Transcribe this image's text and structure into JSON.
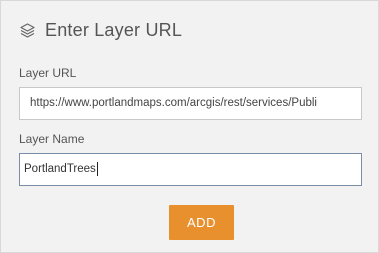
{
  "header": {
    "icon": "layers-icon",
    "title": "Enter Layer URL"
  },
  "form": {
    "url_label": "Layer URL",
    "url_value": "https://www.portlandmaps.com/arcgis/rest/services/Publi",
    "name_label": "Layer Name",
    "name_value": "PortlandTrees"
  },
  "actions": {
    "add_label": "ADD",
    "add_color": "#e8902e"
  }
}
